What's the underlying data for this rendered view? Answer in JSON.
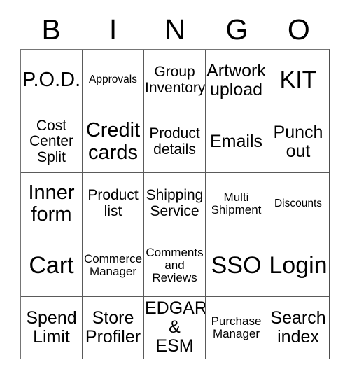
{
  "card": {
    "title": "BINGO",
    "header_letters": [
      "B",
      "I",
      "N",
      "G",
      "O"
    ],
    "grid_size": "5x5",
    "border_color": "#5a5a5a",
    "text_color": "#000000",
    "background_color": "#ffffff",
    "rows": [
      [
        {
          "label": "P.O.D.",
          "size": "lg"
        },
        {
          "label": "Approvals",
          "size": "xxs"
        },
        {
          "label": "Group\nInventory",
          "size": "sm"
        },
        {
          "label": "Artwork\nupload",
          "size": "md"
        },
        {
          "label": "KIT",
          "size": "xl"
        }
      ],
      [
        {
          "label": "Cost\nCenter\nSplit",
          "size": "sm"
        },
        {
          "label": "Credit\ncards",
          "size": "lg"
        },
        {
          "label": "Product\ndetails",
          "size": "sm"
        },
        {
          "label": "Emails",
          "size": "md"
        },
        {
          "label": "Punch\nout",
          "size": "md"
        }
      ],
      [
        {
          "label": "Inner\nform",
          "size": "lg"
        },
        {
          "label": "Product\nlist",
          "size": "sm"
        },
        {
          "label": "Shipping\nService",
          "size": "sm"
        },
        {
          "label": "Multi\nShipment",
          "size": "xs"
        },
        {
          "label": "Discounts",
          "size": "xxs"
        }
      ],
      [
        {
          "label": "Cart",
          "size": "xl"
        },
        {
          "label": "Commerce\nManager",
          "size": "xs"
        },
        {
          "label": "Comments\nand\nReviews",
          "size": "xs"
        },
        {
          "label": "SSO",
          "size": "xl"
        },
        {
          "label": "Login",
          "size": "xl"
        }
      ],
      [
        {
          "label": "Spend\nLimit",
          "size": "md"
        },
        {
          "label": "Store\nProfiler",
          "size": "md"
        },
        {
          "label": "EDGAR\n&\nESM",
          "size": "md"
        },
        {
          "label": "Purchase\nManager",
          "size": "xs"
        },
        {
          "label": "Search\nindex",
          "size": "md"
        }
      ]
    ]
  }
}
